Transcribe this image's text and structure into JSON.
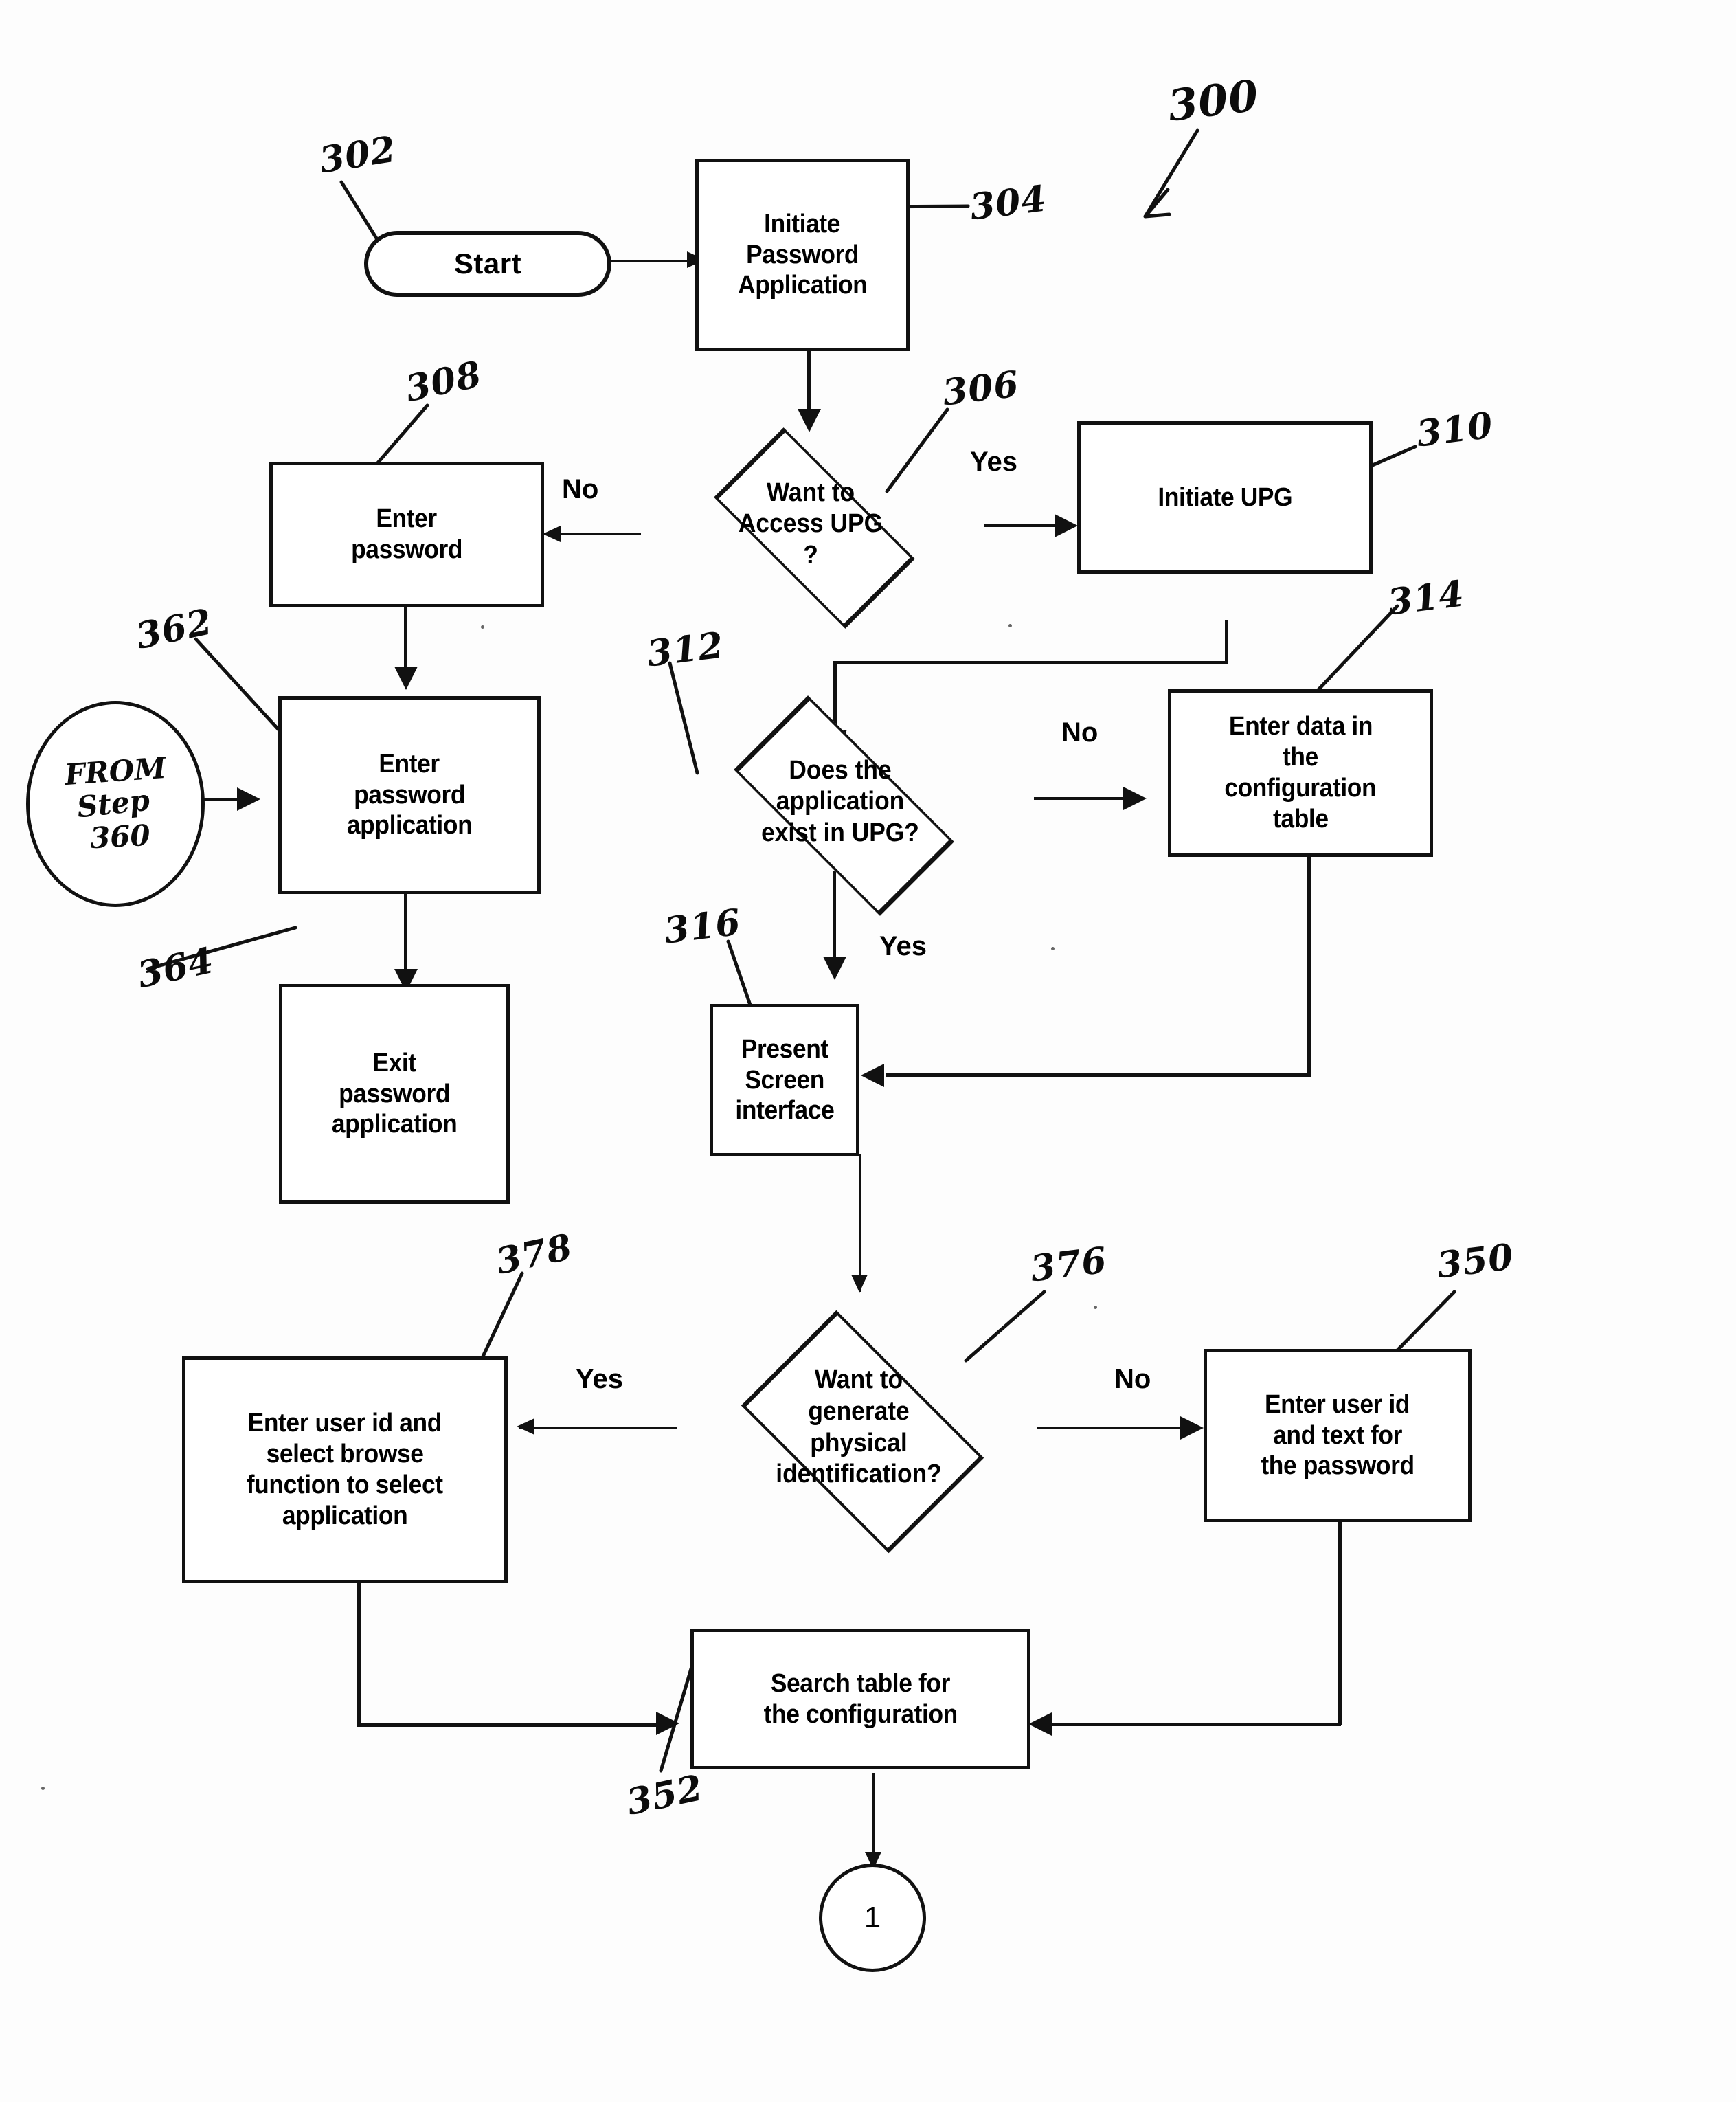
{
  "figure": {
    "reference_numeral": "300",
    "type": "patent-flowchart"
  },
  "chart_data": {
    "type": "diagram",
    "title": "Password application / UPG configuration flowchart",
    "nodes": [
      {
        "ref": "302",
        "shape": "terminator",
        "text": "Start"
      },
      {
        "ref": "304",
        "shape": "process",
        "text": "Initiate Password Application"
      },
      {
        "ref": "306",
        "shape": "decision",
        "text": "Want to Access UPG ?"
      },
      {
        "ref": "308",
        "shape": "process",
        "text": "Enter password"
      },
      {
        "ref": "310",
        "shape": "process",
        "text": "Initiate UPG"
      },
      {
        "ref": "312",
        "shape": "decision",
        "text": "Does the application exist in UPG?"
      },
      {
        "ref": "314",
        "shape": "process",
        "text": "Enter data in the configuration table"
      },
      {
        "ref": "316",
        "shape": "process",
        "text": "Present Screen interface"
      },
      {
        "ref": "350",
        "shape": "process",
        "text": "Enter user id and text for the password"
      },
      {
        "ref": "352",
        "shape": "process",
        "text": "Search table for the configuration"
      },
      {
        "ref": "362",
        "shape": "process",
        "text": "Enter password application"
      },
      {
        "ref": "364",
        "shape": "process",
        "text": "Exit password application"
      },
      {
        "ref": "376",
        "shape": "decision",
        "text": "Want to generate physical identification?"
      },
      {
        "ref": "378",
        "shape": "process",
        "text": "Enter user id and select browse function to select application"
      },
      {
        "ref": "",
        "shape": "off-page-connector",
        "text": "1"
      },
      {
        "ref": "",
        "shape": "off-page-connector",
        "text": "FROM Step 360"
      }
    ],
    "edges": [
      {
        "from": "302",
        "to": "304",
        "label": ""
      },
      {
        "from": "304",
        "to": "306",
        "label": ""
      },
      {
        "from": "306",
        "to": "308",
        "label": "No"
      },
      {
        "from": "306",
        "to": "310",
        "label": "Yes"
      },
      {
        "from": "308",
        "to": "362",
        "label": ""
      },
      {
        "from": "310",
        "to": "312",
        "label": ""
      },
      {
        "from": "362",
        "to": "364",
        "label": ""
      },
      {
        "from": "312",
        "to": "314",
        "label": "No"
      },
      {
        "from": "312",
        "to": "316",
        "label": "Yes"
      },
      {
        "from": "314",
        "to": "316",
        "label": ""
      },
      {
        "from": "316",
        "to": "376",
        "label": ""
      },
      {
        "from": "376",
        "to": "378",
        "label": "Yes"
      },
      {
        "from": "376",
        "to": "350",
        "label": "No"
      },
      {
        "from": "378",
        "to": "352",
        "label": ""
      },
      {
        "from": "350",
        "to": "352",
        "label": ""
      },
      {
        "from": "352",
        "to": "1",
        "label": ""
      },
      {
        "from": "FROM Step 360",
        "to": "362",
        "label": ""
      }
    ]
  },
  "nodes": {
    "start": {
      "label": "Start",
      "ref": "302"
    },
    "initiate_password_application": {
      "line1": "Initiate",
      "line2": "Password",
      "line3": "Application",
      "ref": "304"
    },
    "want_access_upg": {
      "line1": "Want to",
      "line2": "Access UPG",
      "line3": "?",
      "ref": "306"
    },
    "enter_password": {
      "line1": "Enter",
      "line2": "password",
      "ref": "308"
    },
    "initiate_upg": {
      "label": "Initiate UPG",
      "ref": "310"
    },
    "app_exists_upg": {
      "line1": "Does the",
      "line2": "application",
      "line3": "exist in UPG?",
      "ref": "312"
    },
    "enter_data_config_table": {
      "line1": "Enter data in",
      "line2": "the",
      "line3": "configuration",
      "line4": "table",
      "ref": "314"
    },
    "present_screen_interface": {
      "line1": "Present",
      "line2": "Screen",
      "line3": "interface",
      "ref": "316"
    },
    "enter_password_application": {
      "line1": "Enter",
      "line2": "password",
      "line3": "application",
      "ref": "362"
    },
    "exit_password_application": {
      "line1": "Exit",
      "line2": "password",
      "line3": "application",
      "ref": "364"
    },
    "want_generate_physical_id": {
      "line1": "Want to",
      "line2": "generate",
      "line3": "physical",
      "line4": "identification?",
      "ref": "376"
    },
    "enter_userid_browse": {
      "line1": "Enter user id and",
      "line2": "select  browse",
      "line3": "function to select",
      "line4": "application",
      "ref": "378"
    },
    "enter_userid_text_password": {
      "line1": "Enter user id",
      "line2": "and text for",
      "line3": "the password",
      "ref": "350"
    },
    "search_table_configuration": {
      "line1": "Search table for",
      "line2": "the configuration",
      "ref": "352"
    },
    "connector_one": {
      "label": "1"
    },
    "from_step_360": {
      "line1": "FROM",
      "line2": "Step",
      "line3": "360",
      "ref": "362"
    }
  },
  "branch_labels": {
    "upg_no": "No",
    "upg_yes": "Yes",
    "exists_no": "No",
    "exists_yes": "Yes",
    "physid_yes": "Yes",
    "physid_no": "No"
  },
  "reference_numerals": {
    "fig": "300",
    "start": "302",
    "initiate_password_application": "304",
    "want_access_upg": "306",
    "enter_password": "308",
    "initiate_upg": "310",
    "app_exists_upg": "312",
    "enter_data_config_table": "314",
    "present_screen_interface": "316",
    "enter_userid_text_password": "350",
    "search_table_configuration": "352",
    "enter_password_application": "362",
    "exit_password_application": "364",
    "want_generate_physical_id": "376",
    "enter_userid_browse": "378"
  },
  "colors": {
    "ink": "#111111",
    "paper": "#fdfdfd"
  }
}
